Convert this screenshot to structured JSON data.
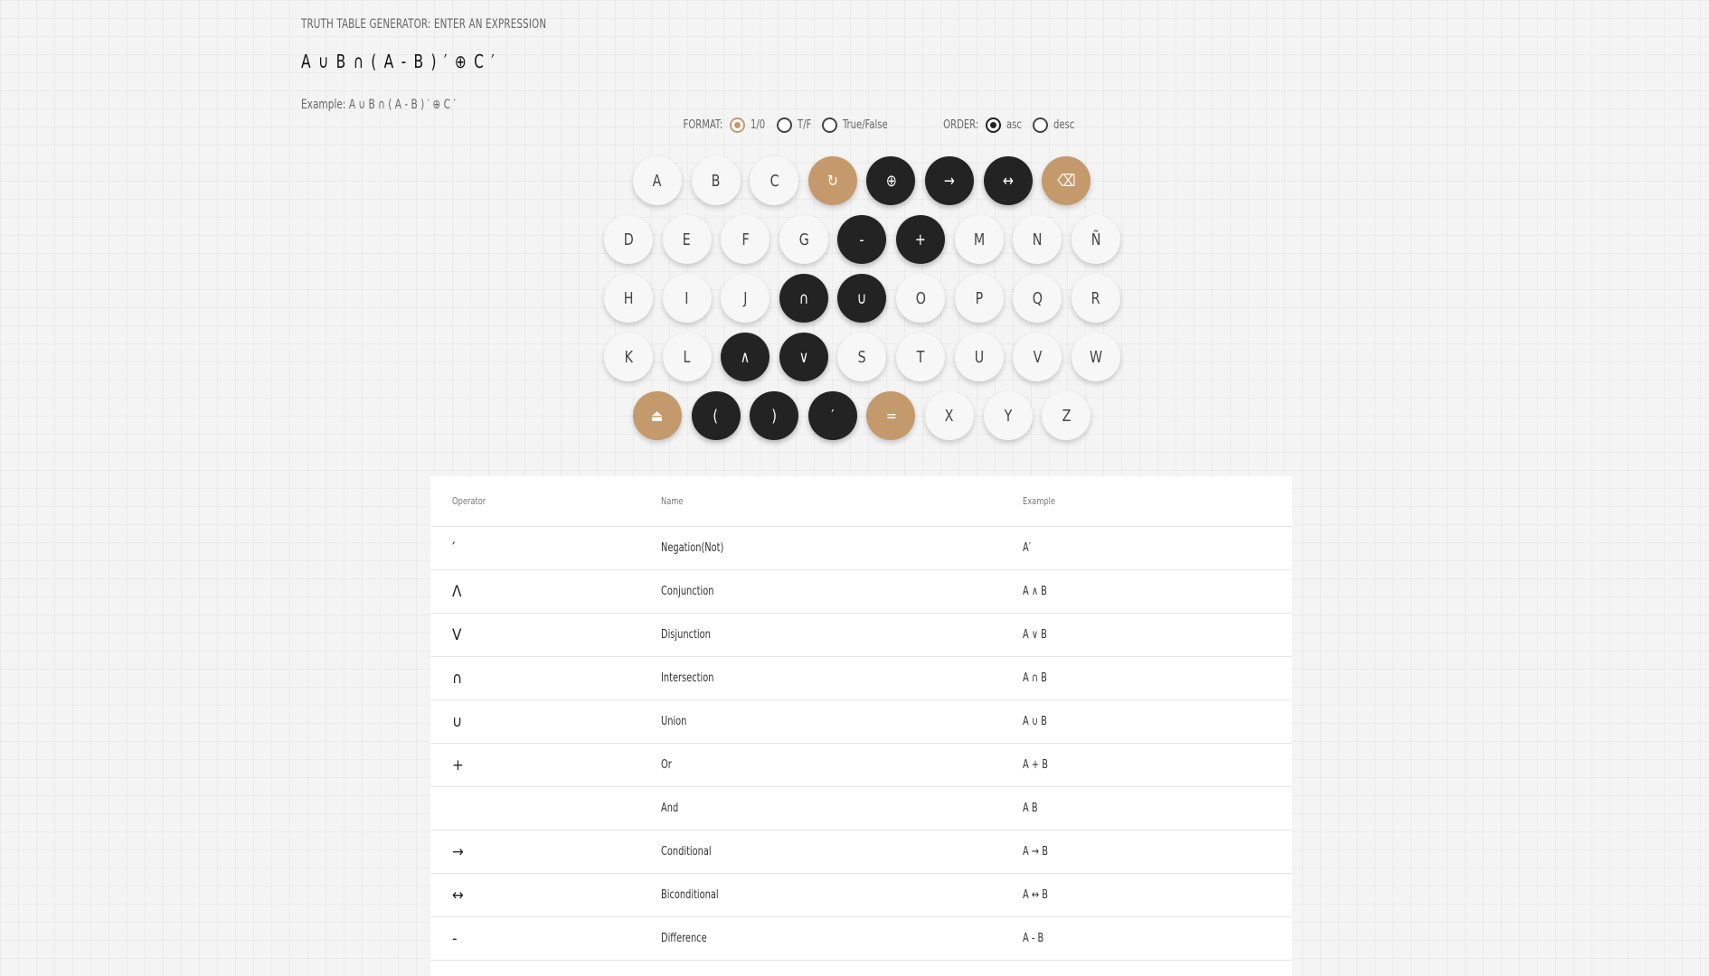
{
  "header": {
    "label": "TRUTH TABLE GENERATOR: ENTER AN EXPRESSION",
    "expression": "A ∪ B ∩ ( A - B ) ′ ⊕ C ′",
    "example": "Example: A ∪ B ∩ ( A - B ) ′ ⊕ C ′"
  },
  "options": {
    "format_label": "FORMAT:",
    "format_choices": [
      "1/0",
      "T/F",
      "True/False"
    ],
    "format_selected": "1/0",
    "order_label": "ORDER:",
    "order_choices": [
      "asc",
      "desc"
    ],
    "order_selected": "asc"
  },
  "keypad": {
    "rows": [
      [
        {
          "label": "A",
          "kind": "letter",
          "icon": ""
        },
        {
          "label": "B",
          "kind": "letter",
          "icon": ""
        },
        {
          "label": "C",
          "kind": "letter",
          "icon": ""
        },
        {
          "label": "↻",
          "kind": "tan",
          "icon": "refresh-icon"
        },
        {
          "label": "⊕",
          "kind": "op",
          "icon": ""
        },
        {
          "label": "→",
          "kind": "op",
          "icon": ""
        },
        {
          "label": "↔",
          "kind": "op",
          "icon": ""
        },
        {
          "label": "⌫",
          "kind": "tan",
          "icon": "backspace-icon"
        }
      ],
      [
        {
          "label": "D",
          "kind": "letter",
          "icon": ""
        },
        {
          "label": "E",
          "kind": "letter",
          "icon": ""
        },
        {
          "label": "F",
          "kind": "letter",
          "icon": ""
        },
        {
          "label": "G",
          "kind": "letter",
          "icon": ""
        },
        {
          "label": "-",
          "kind": "op",
          "icon": ""
        },
        {
          "label": "+",
          "kind": "op",
          "icon": ""
        },
        {
          "label": "M",
          "kind": "letter",
          "icon": ""
        },
        {
          "label": "N",
          "kind": "letter",
          "icon": ""
        },
        {
          "label": "Ñ",
          "kind": "letter",
          "icon": ""
        }
      ],
      [
        {
          "label": "H",
          "kind": "letter",
          "icon": ""
        },
        {
          "label": "I",
          "kind": "letter",
          "icon": ""
        },
        {
          "label": "J",
          "kind": "letter",
          "icon": ""
        },
        {
          "label": "∩",
          "kind": "op",
          "icon": ""
        },
        {
          "label": "∪",
          "kind": "op",
          "icon": ""
        },
        {
          "label": "O",
          "kind": "letter",
          "icon": ""
        },
        {
          "label": "P",
          "kind": "letter",
          "icon": ""
        },
        {
          "label": "Q",
          "kind": "letter",
          "icon": ""
        },
        {
          "label": "R",
          "kind": "letter",
          "icon": ""
        }
      ],
      [
        {
          "label": "K",
          "kind": "letter",
          "icon": ""
        },
        {
          "label": "L",
          "kind": "letter",
          "icon": ""
        },
        {
          "label": "∧",
          "kind": "op",
          "icon": ""
        },
        {
          "label": "∨",
          "kind": "op",
          "icon": ""
        },
        {
          "label": "S",
          "kind": "letter",
          "icon": ""
        },
        {
          "label": "T",
          "kind": "letter",
          "icon": ""
        },
        {
          "label": "U",
          "kind": "letter",
          "icon": ""
        },
        {
          "label": "V",
          "kind": "letter",
          "icon": ""
        },
        {
          "label": "W",
          "kind": "letter",
          "icon": ""
        }
      ],
      [
        {
          "label": "⏏",
          "kind": "tan",
          "icon": "eject-icon"
        },
        {
          "label": "(",
          "kind": "op",
          "icon": ""
        },
        {
          "label": ")",
          "kind": "op",
          "icon": ""
        },
        {
          "label": "′",
          "kind": "op",
          "icon": ""
        },
        {
          "label": "=",
          "kind": "tan",
          "icon": "equals-icon"
        },
        {
          "label": "X",
          "kind": "letter",
          "icon": ""
        },
        {
          "label": "Y",
          "kind": "letter",
          "icon": ""
        },
        {
          "label": "Z",
          "kind": "letter",
          "icon": ""
        }
      ]
    ]
  },
  "operators_table": {
    "headers": [
      "Operator",
      "Name",
      "Example"
    ],
    "rows": [
      {
        "operator": "′",
        "name": "Negation(Not)",
        "example": "A′"
      },
      {
        "operator": "Λ",
        "name": "Conjunction",
        "example": "A ∧ B"
      },
      {
        "operator": "V",
        "name": "Disjunction",
        "example": "A ∨ B"
      },
      {
        "operator": "∩",
        "name": "Intersection",
        "example": "A ∩ B"
      },
      {
        "operator": "∪",
        "name": "Union",
        "example": "A ∪ B"
      },
      {
        "operator": "+",
        "name": "Or",
        "example": "A + B"
      },
      {
        "operator": "",
        "name": "And",
        "example": "A B"
      },
      {
        "operator": "→",
        "name": "Conditional",
        "example": "A → B"
      },
      {
        "operator": "↔",
        "name": "Biconditional",
        "example": "A ↔ B"
      },
      {
        "operator": "-",
        "name": "Difference",
        "example": "A - B"
      },
      {
        "operator": "⊕",
        "name": "",
        "example": ""
      }
    ]
  },
  "colors": {
    "accent_tan": "#c49a6c",
    "operator_dark": "#232323",
    "letter_key": "#f7f7f7"
  }
}
